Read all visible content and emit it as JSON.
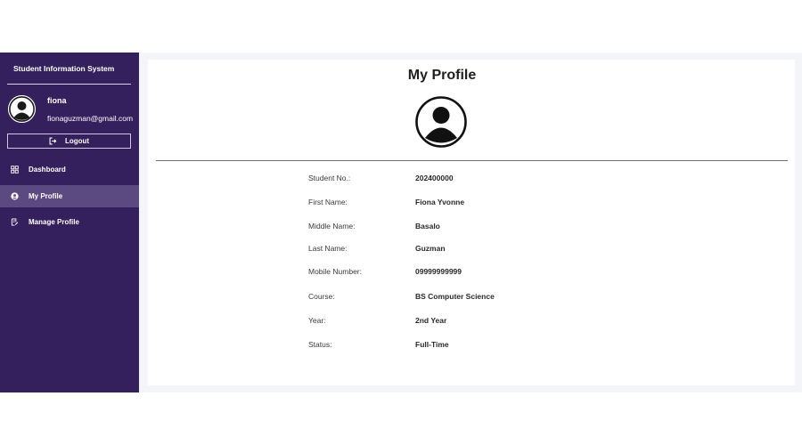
{
  "sidebar": {
    "title": "Student Information System",
    "user": {
      "name": "fiona",
      "email": "fionaguzman@gmail.com"
    },
    "logout_label": "Logout",
    "nav": [
      {
        "label": "Dashboard",
        "icon": "grid-icon",
        "active": false
      },
      {
        "label": "My Profile",
        "icon": "user-icon",
        "active": true
      },
      {
        "label": "Manage Profile",
        "icon": "edit-document-icon",
        "active": false
      }
    ]
  },
  "main": {
    "title": "My Profile",
    "fields": [
      {
        "label": "Student No.:",
        "value": "202400000"
      },
      {
        "label": "First Name:",
        "value": "Fiona Yvonne"
      },
      {
        "label": "Middle Name:",
        "value": "Basalo"
      },
      {
        "label": "Last Name:",
        "value": "Guzman"
      },
      {
        "label": "Mobile Number:",
        "value": "09999999999"
      },
      {
        "label": "Course:",
        "value": "BS Computer Science"
      },
      {
        "label": "Year:",
        "value": "2nd Year"
      },
      {
        "label": "Status:",
        "value": "Full-Time"
      }
    ]
  },
  "colors": {
    "sidebar_bg": "#33205c",
    "sidebar_active": "#5b4a82",
    "page_bg": "#f3f5f9",
    "card_bg": "#ffffff"
  }
}
